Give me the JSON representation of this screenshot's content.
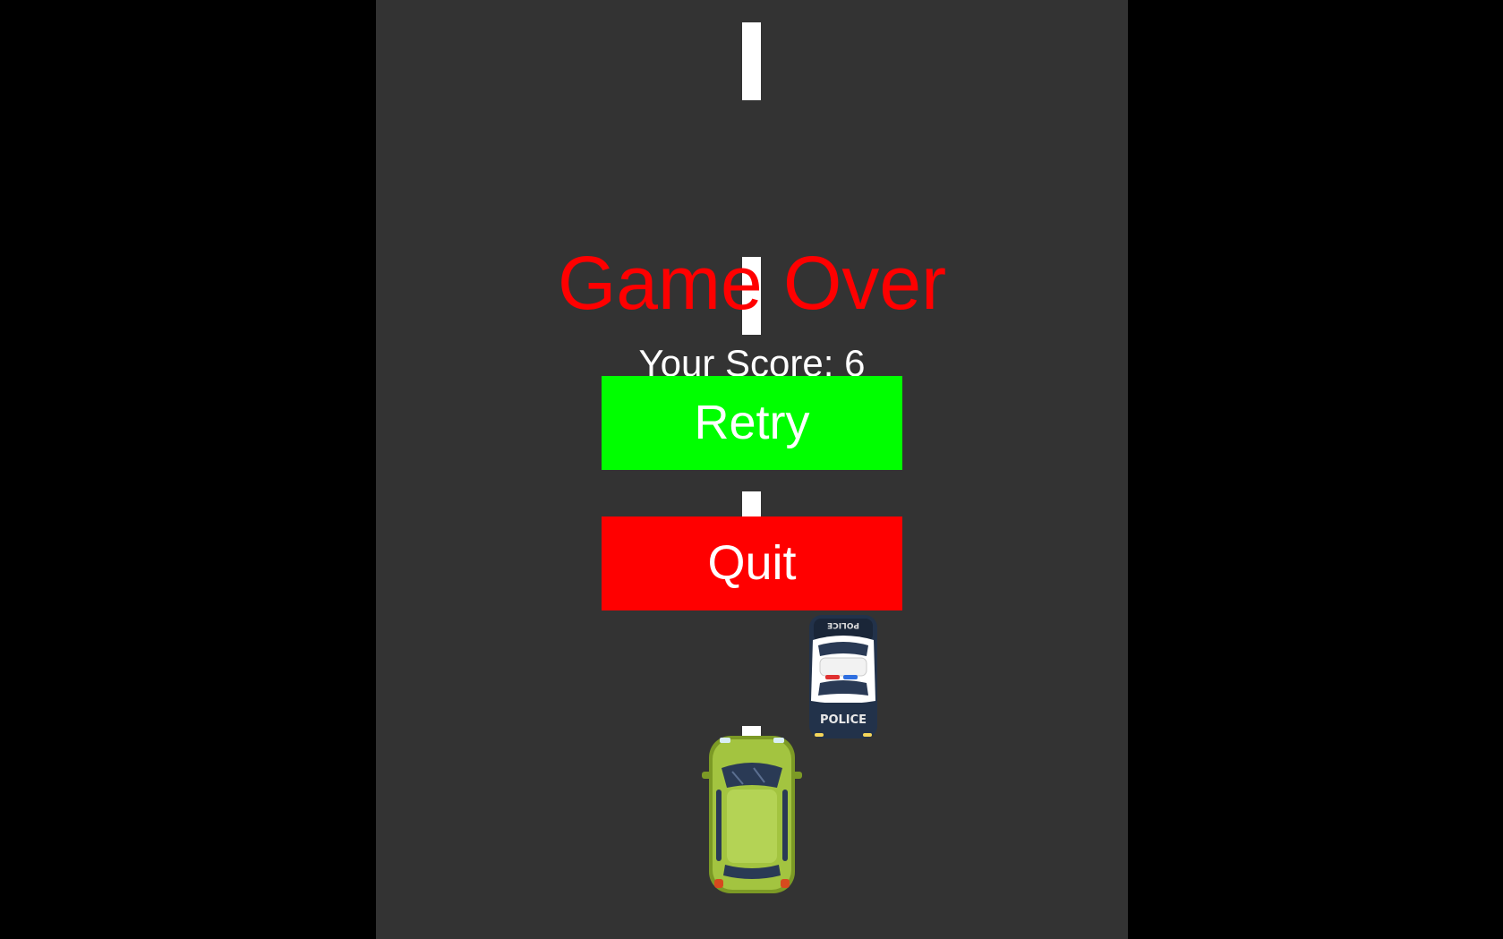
{
  "game": {
    "title": "Game Over",
    "score_text": "Your Score: 6",
    "score": 6
  },
  "buttons": {
    "retry_label": "Retry",
    "quit_label": "Quit"
  },
  "sprites": {
    "police_car_label": "POLICE",
    "police_car_roof_label": "POLICE"
  },
  "colors": {
    "background": "#000000",
    "road": "#333333",
    "lane_marking": "#ffffff",
    "title": "#ff0000",
    "retry_button": "#00ff00",
    "quit_button": "#ff0000",
    "player_car": "#a3c440",
    "police_car_body": "#ffffff",
    "police_car_hood": "#22324a"
  }
}
